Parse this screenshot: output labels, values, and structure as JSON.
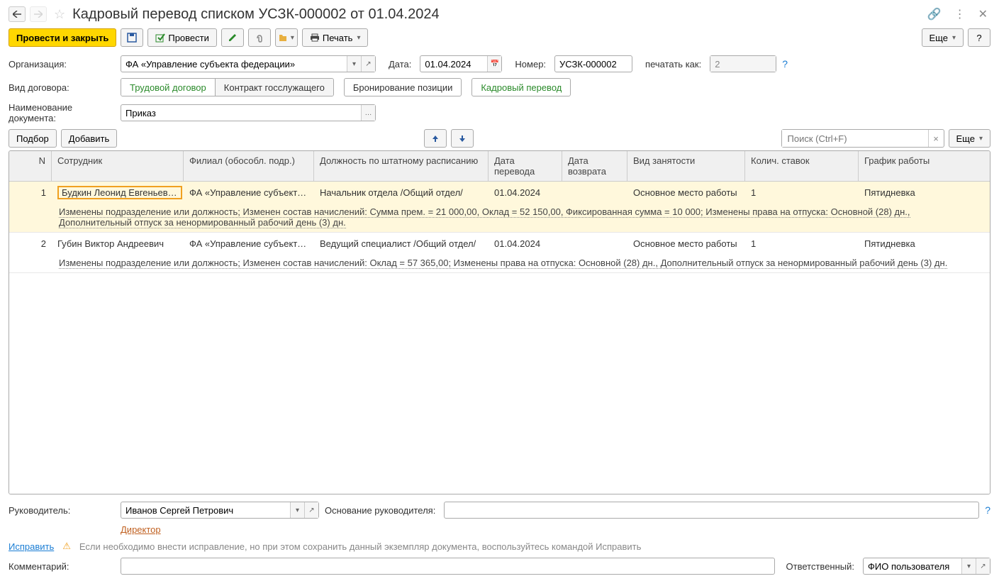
{
  "title": "Кадровый перевод списком УСЗК-000002 от 01.04.2024",
  "toolbar": {
    "post_close": "Провести и закрыть",
    "post": "Провести",
    "print": "Печать",
    "more": "Еще",
    "help": "?"
  },
  "form": {
    "org_label": "Организация:",
    "org_value": "ФА «Управление субъекта федерации»",
    "date_label": "Дата:",
    "date_value": "01.04.2024",
    "num_label": "Номер:",
    "num_value": "УСЗК-000002",
    "print_as_label": "печатать как:",
    "print_as_value": "2",
    "contract_label": "Вид договора:",
    "tab_trud": "Трудовой договор",
    "tab_gos": "Контракт госслужащего",
    "tab_bron": "Бронирование позиции",
    "tab_kadr": "Кадровый перевод",
    "docname_label": "Наименование документа:",
    "docname_value": "Приказ"
  },
  "table_toolbar": {
    "select": "Подбор",
    "add": "Добавить",
    "search_placeholder": "Поиск (Ctrl+F)",
    "more": "Еще"
  },
  "columns": {
    "n": "N",
    "emp": "Сотрудник",
    "fil": "Филиал (обособл. подр.)",
    "pos": "Должность по штатному расписанию",
    "dt1": "Дата перевода",
    "dt2": "Дата возврата",
    "zan": "Вид занятости",
    "stav": "Колич. ставок",
    "graf": "График работы"
  },
  "rows": [
    {
      "n": "1",
      "emp": "Будкин Леонид Евгеньевич",
      "fil": "ФА «Управление субъекта ф…",
      "pos": "Начальник отдела /Общий отдел/",
      "dt1": "01.04.2024",
      "dt2": "",
      "zan": "Основное место работы",
      "stav": "1",
      "graf": "Пятидневка",
      "detail": "Изменены подразделение или должность; Изменен состав начислений: Сумма прем. = 21 000,00, Оклад = 52 150,00, Фиксированная сумма = 10 000; Изменены права на отпуска: Основной (28) дн., Дополнительный отпуск за ненормированный рабочий день (3) дн."
    },
    {
      "n": "2",
      "emp": "Губин Виктор Андреевич",
      "fil": "ФА «Управление субъекта ф…",
      "pos": "Ведущий специалист /Общий отдел/",
      "dt1": "01.04.2024",
      "dt2": "",
      "zan": "Основное место работы",
      "stav": "1",
      "graf": "Пятидневка",
      "detail": "Изменены подразделение или должность; Изменен состав начислений: Оклад = 57 365,00; Изменены права на отпуска: Основной (28) дн., Дополнительный отпуск за ненормированный рабочий день (3) дн."
    }
  ],
  "footer": {
    "mgr_label": "Руководитель:",
    "mgr_value": "Иванов Сергей Петрович",
    "mgr_basis_label": "Основание руководителя:",
    "mgr_pos": "Директор",
    "fix_link": "Исправить",
    "fix_note": "Если необходимо внести исправление, но при этом сохранить данный экземпляр документа, воспользуйтесь командой Исправить",
    "comment_label": "Комментарий:",
    "resp_label": "Ответственный:",
    "resp_value": "ФИО пользователя"
  }
}
